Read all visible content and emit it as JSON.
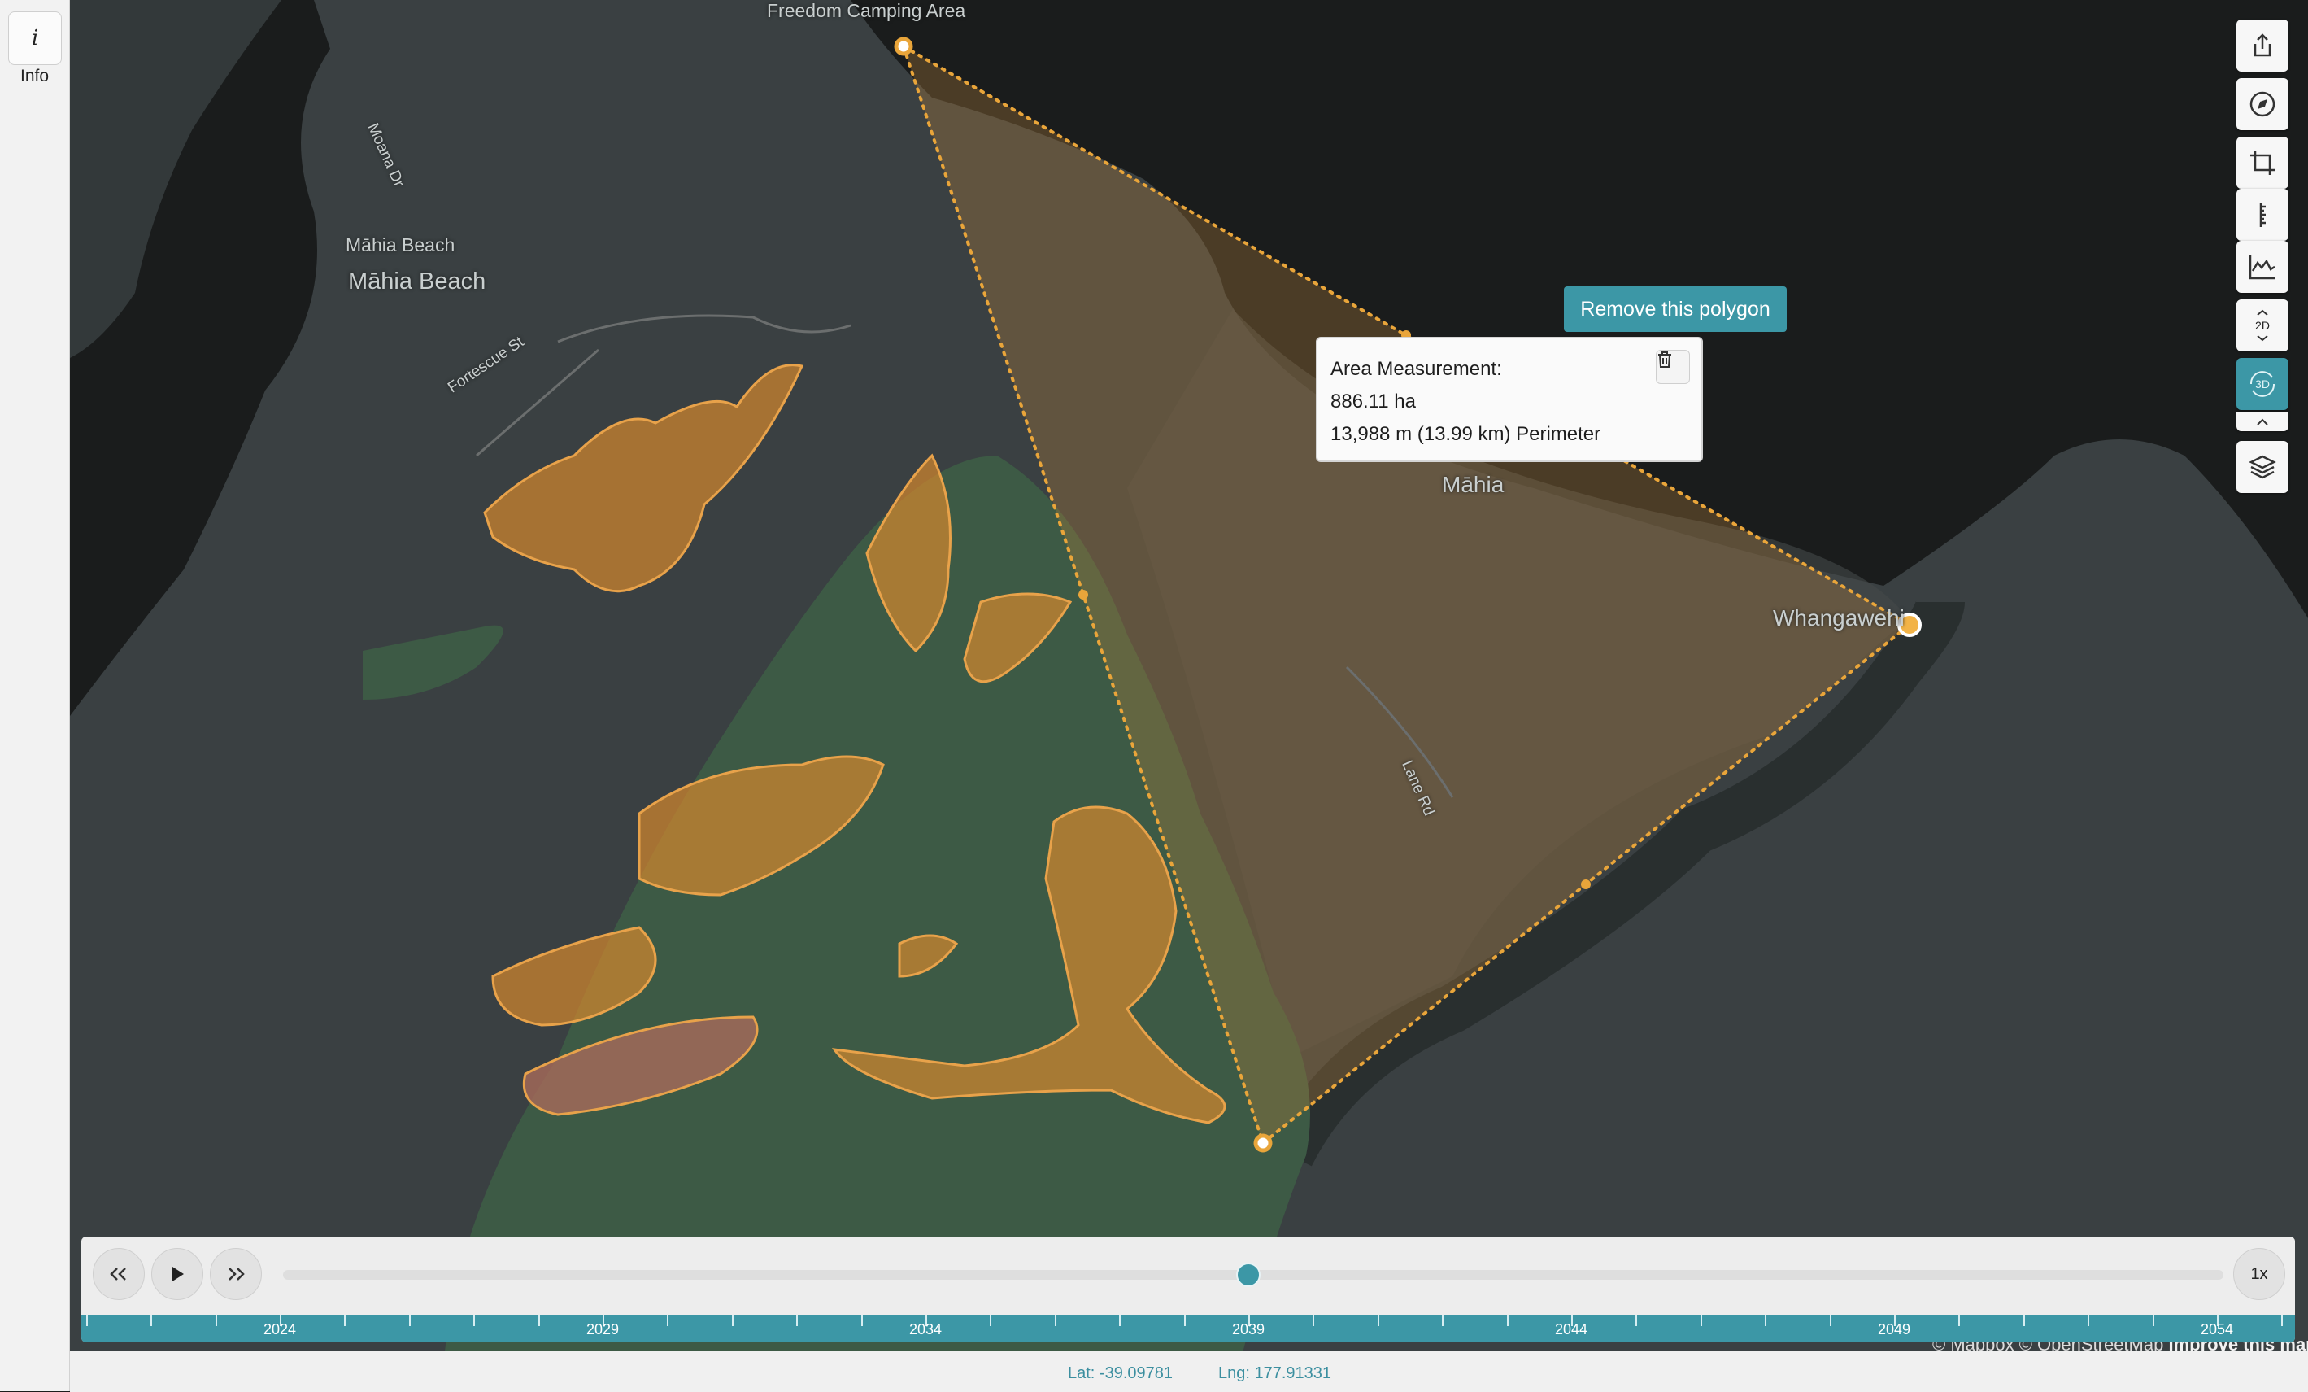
{
  "sidebar": {
    "info_icon_glyph": "i",
    "info_label": "Info"
  },
  "map": {
    "place_labels": {
      "freedom_camping": "Freedom Camping Area",
      "moana_dr": "Moana Dr",
      "mahia_beach_small": "Māhia Beach",
      "mahia_beach_large": "Māhia Beach",
      "fortescue_st": "Fortescue St",
      "mahia": "Māhia",
      "whangawehi": "Whangawehi",
      "lane_rd": "Lane Rd"
    },
    "colors": {
      "water": "#1a1c1c",
      "land": "#3a4042",
      "forest": "#3d5a45",
      "highlight": "#d4882e",
      "polygon": "#e0a23a",
      "accent": "#3c97a6"
    }
  },
  "popup": {
    "title": "Area Measurement:",
    "area": "886.11 ha",
    "perimeter": "13,988 m (13.99 km) Perimeter",
    "delete_icon": "trash-icon"
  },
  "remove_polygon_label": "Remove this polygon",
  "toolbar": {
    "tools": [
      {
        "name": "share-icon",
        "active": false
      },
      {
        "name": "compass-icon",
        "active": false
      },
      {
        "name": "crop-icon",
        "active": false
      },
      {
        "name": "ruler-icon",
        "active": false
      },
      {
        "name": "elevation-profile-icon",
        "active": false
      },
      {
        "name": "2d-toggle-icon",
        "label": "2D",
        "active": false
      },
      {
        "name": "3d-toggle-icon",
        "label": "3D",
        "active": true
      },
      {
        "name": "layers-icon",
        "active": false
      }
    ],
    "label_2d": "2D",
    "label_3d": "3D"
  },
  "timeline": {
    "prev_icon": "rewind-icon",
    "play_icon": "play-icon",
    "next_icon": "fast-forward-icon",
    "speed_label": "1x",
    "current_year": 2039,
    "year_range": [
      2021,
      2055
    ],
    "years": [
      "2024",
      "2029",
      "2034",
      "2039",
      "2044",
      "2049",
      "2054"
    ]
  },
  "attribution": {
    "text": "© Mapbox © OpenStreetMap",
    "improve": "Improve this map"
  },
  "status": {
    "lat": "Lat: -39.09781",
    "lng": "Lng: 177.91331"
  }
}
